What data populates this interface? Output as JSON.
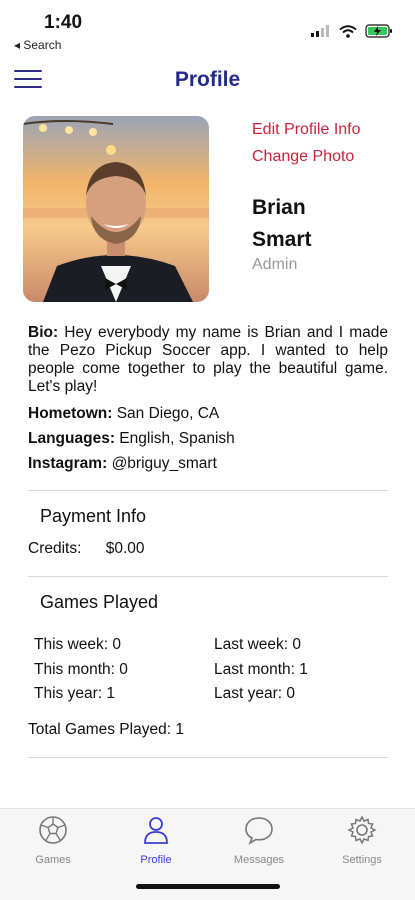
{
  "status": {
    "time": "1:40",
    "back_label": "◂ Search"
  },
  "nav": {
    "title": "Profile"
  },
  "profile": {
    "edit_label": "Edit Profile Info",
    "change_photo_label": "Change Photo",
    "first_name": "Brian",
    "last_name": "Smart",
    "role": "Admin",
    "bio_label": "Bio:",
    "bio": "Hey everybody my name is Brian and I made the Pezo Pickup Soccer app. I wanted to help people come together to play the beautiful game. Let's play!",
    "hometown_label": "Hometown:",
    "hometown": "San Diego, CA",
    "languages_label": "Languages:",
    "languages": "English, Spanish",
    "instagram_label": "Instagram:",
    "instagram": "@briguy_smart"
  },
  "payment": {
    "title": "Payment Info",
    "credits_label": "Credits:",
    "credits_value": "$0.00"
  },
  "games": {
    "title": "Games Played",
    "this_week": "This week: 0",
    "last_week": "Last week: 0",
    "this_month": "This month: 0",
    "last_month": "Last month: 1",
    "this_year": "This year: 1",
    "last_year": "Last year: 0",
    "total": "Total Games Played: 1"
  },
  "tabs": [
    {
      "label": "Games",
      "icon": "soccer-ball-icon"
    },
    {
      "label": "Profile",
      "icon": "person-icon"
    },
    {
      "label": "Messages",
      "icon": "chat-bubble-icon"
    },
    {
      "label": "Settings",
      "icon": "gear-icon"
    }
  ],
  "colors": {
    "accent": "#3a3fd6",
    "title": "#222a8c",
    "link": "#c8243c"
  }
}
